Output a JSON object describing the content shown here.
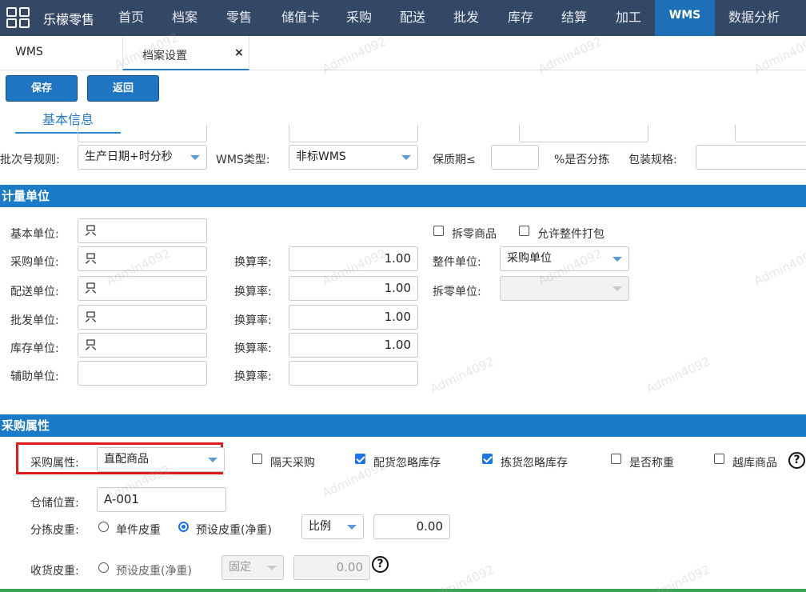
{
  "nav": {
    "brand": "乐檬零售",
    "items": [
      "首页",
      "档案",
      "零售",
      "储值卡",
      "采购",
      "配送",
      "批发",
      "库存",
      "结算",
      "加工",
      "WMS",
      "数据分析"
    ],
    "active": "WMS"
  },
  "tabs": {
    "first": "WMS",
    "active_label": "档案设置",
    "close": "×"
  },
  "toolbar": {
    "save": "保存",
    "back": "返回"
  },
  "subtab": "基本信息",
  "top_row": {
    "batch_rule_label": "批次号规则:",
    "batch_rule_value": "生产日期+时分秒",
    "wms_type_label": "WMS类型:",
    "wms_type_value": "非标WMS",
    "shelf_life_label": "保质期≤",
    "shelf_life_value": "",
    "is_pick_label": "%是否分拣",
    "package_spec_label": "包装规格:",
    "package_spec_value": ""
  },
  "unit_section": {
    "title": "计量单位",
    "rows": [
      {
        "label": "基本单位:",
        "value": "只",
        "rate_label": "",
        "rate": ""
      },
      {
        "label": "采购单位:",
        "value": "只",
        "rate_label": "换算率:",
        "rate": "1.00"
      },
      {
        "label": "配送单位:",
        "value": "只",
        "rate_label": "换算率:",
        "rate": "1.00"
      },
      {
        "label": "批发单位:",
        "value": "只",
        "rate_label": "换算率:",
        "rate": "1.00"
      },
      {
        "label": "库存单位:",
        "value": "只",
        "rate_label": "换算率:",
        "rate": "1.00"
      },
      {
        "label": "辅助单位:",
        "value": "",
        "rate_label": "换算率:",
        "rate": ""
      }
    ],
    "split_goods": {
      "label": "拆零商品",
      "checked": false
    },
    "allow_pack": {
      "label": "允许整件打包",
      "checked": false
    },
    "whole_unit_label": "整件单位:",
    "whole_unit_value": "采购单位",
    "split_unit_label": "拆零单位:",
    "split_unit_value": ""
  },
  "purchase_section": {
    "title": "采购属性",
    "attr_label": "采购属性:",
    "attr_value": "直配商品",
    "checks": [
      {
        "label": "隔天采购",
        "checked": false
      },
      {
        "label": "配货忽略库存",
        "checked": true
      },
      {
        "label": "拣货忽略库存",
        "checked": true
      },
      {
        "label": "是否称重",
        "checked": false
      },
      {
        "label": "越库商品",
        "checked": false
      }
    ],
    "help_glyph": "?",
    "storage_label": "仓储位置:",
    "storage_value": "A-001",
    "sort_tare_label": "分拣皮重:",
    "sort_tare_opt1": "单件皮重",
    "sort_tare_opt2": "预设皮重(净重)",
    "sort_tare_mode": "比例",
    "sort_tare_value": "0.00",
    "recv_tare_label": "收货皮重:",
    "recv_tare_opt": "预设皮重(净重)",
    "recv_tare_mode": "固定",
    "recv_tare_value": "0.00"
  },
  "watermark": "Admin4092",
  "colors": {
    "nav_bg": "#334865",
    "nav_active": "#1d6fb7",
    "section_bg": "#1b7bc6",
    "highlight": "#e21a1a"
  }
}
